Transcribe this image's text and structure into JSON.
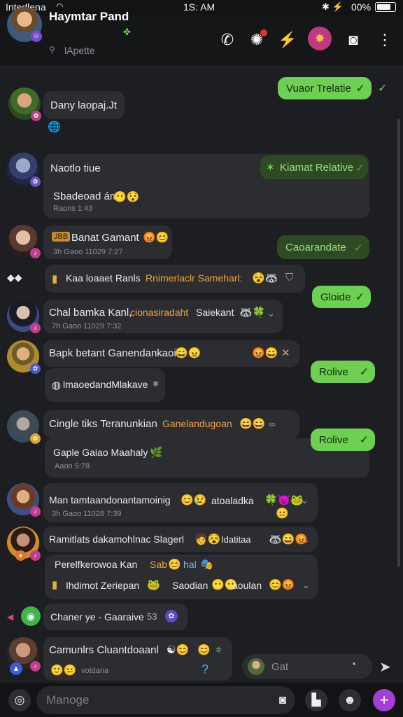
{
  "status_bar": {
    "carrier": "Intedlena",
    "wifi_icon": "wifi-icon",
    "time": "1S: AM",
    "icons": "✱ ⚡",
    "battery_text": "00%"
  },
  "header": {
    "name": "Haymtar Pand",
    "subtitle": "lApette",
    "actions": [
      "phone-icon",
      "sticker-icon",
      "lightning-icon",
      "emoji-icon",
      "camera-icon",
      "more-icon"
    ]
  },
  "messages": {
    "m1_out": "Vuaor Trelatie",
    "m2_name": "Dany laopaj.Jt",
    "m3_title": "Naotlo tiue",
    "m3_out": "Kiamat Relative",
    "m3_line": "Sbadeoad ám",
    "m3_meta": "Raons 1:43",
    "m4_name": "Banat Gamant",
    "m4_prefix": "JBB",
    "m4_meta": "3h Gaoo 11029 7:27",
    "m4_out": "Caoarandate",
    "m5_text": "Kaa loaaet Ranls",
    "m5_orange": "Rnimerlaclr Sameharl:",
    "m5_out": "Gloide",
    "m6_name": "Chal bamka Kanl,",
    "m6_orange": "cionasiradaht",
    "m6_tail": "Saiekant",
    "m6_meta": "7h Gaoo 11029 7:32",
    "m7_name": "Bapk betant Ganendankaoii",
    "m7_sub": "lmaoedandMlakave",
    "m7_out": "Rolive",
    "m8_name": "Cingle tiks Teranunkian",
    "m8_orange": "Ganelandugoan",
    "m8_line": "Gaple Gaiao Maahaly",
    "m8_meta": "Aaon 5:78",
    "m8_out": "Rolive",
    "m9_name": "Man tamtaandonantamoinig",
    "m9_tail": "atoaladka",
    "m9_meta": "3h Gaoo 11028 7:39",
    "m10_name": "Ramitlats dakamohlnac Slagerl",
    "m10_tail": "Idatitaa",
    "m10_line": "Perelfkerowoa Kan",
    "m10_orange": "Sab",
    "m10_blue": "hal",
    "m10_line2": "Ihdimot Zeriepan",
    "m10_line2b": "Saodian",
    "m10_line2c": "aoulan",
    "m11_text": "Chaner ye - Gaaraive",
    "m11_num": "53",
    "m12_name": "Camunlrs Cluantdoaanl",
    "m12_sub": "votdana",
    "mini_placeholder": "Gat"
  },
  "input": {
    "placeholder": "Manoge",
    "left_icon": "camera-icon",
    "right_icons": [
      "gallery-icon",
      "document-icon",
      "emoji-icon",
      "plus-icon"
    ]
  },
  "colors": {
    "accent_green": "#6fcf52",
    "accent_purple": "#a43fd6",
    "orange_text": "#f3a23a",
    "background": "#1c1e21"
  }
}
